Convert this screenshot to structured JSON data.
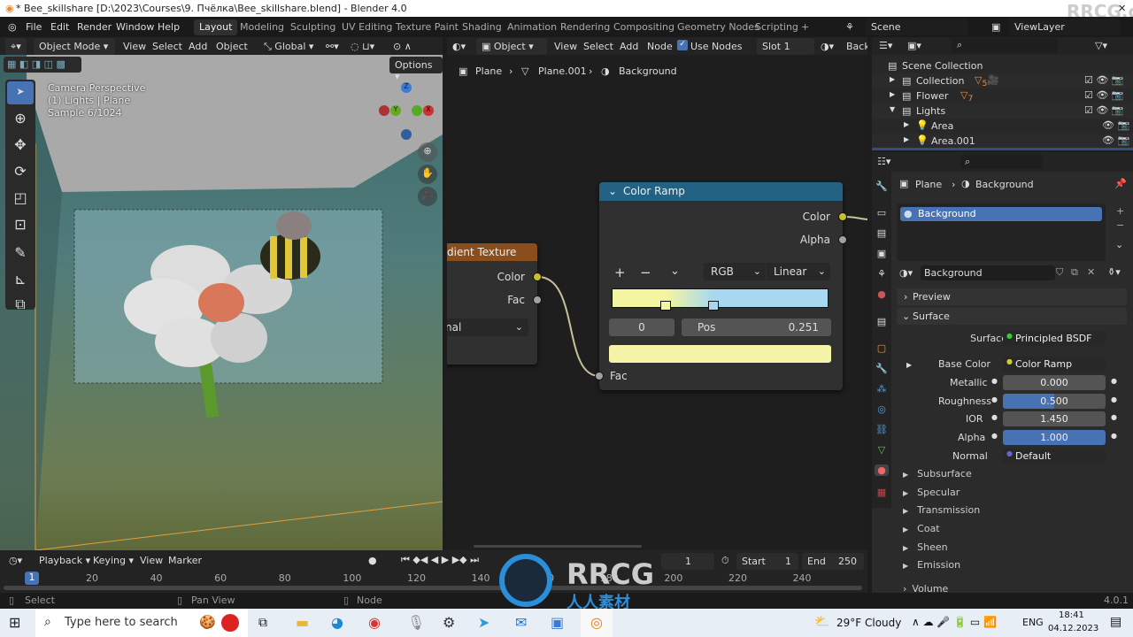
{
  "window": {
    "title": "* Bee_skillshare [D:\\2023\\Courses\\9. Пчёлка\\Bee_skillshare.blend] - Blender 4.0"
  },
  "menu": [
    "File",
    "Edit",
    "Render",
    "Window",
    "Help"
  ],
  "workspaces": [
    "Layout",
    "Modeling",
    "Sculpting",
    "UV Editing",
    "Texture Paint",
    "Shading",
    "Animation",
    "Rendering",
    "Compositing",
    "Geometry Nodes",
    "Scripting",
    "+"
  ],
  "scene": "Scene",
  "view_layer": "ViewLayer",
  "viewport": {
    "mode": "Object Mode",
    "menus": [
      "View",
      "Select",
      "Add",
      "Object"
    ],
    "transform": "Global",
    "options": "Options",
    "overlay": [
      "Camera Perspective",
      "(1) Lights | Plane",
      "Sample 6/1024"
    ],
    "gizmo": {
      "z": "Z",
      "y": "Y",
      "x": "X"
    }
  },
  "node_editor": {
    "type": "Object",
    "menus": [
      "View",
      "Select",
      "Add",
      "Node"
    ],
    "use_nodes": "Use Nodes",
    "slot": "Slot 1",
    "material": "Backg",
    "breadcrumb": [
      "Plane",
      "Plane.001",
      "Background"
    ],
    "gradient_node": {
      "title": "dient Texture",
      "outputs": [
        "Color",
        "Fac"
      ],
      "dropdown": "nal"
    },
    "color_ramp": {
      "title": "Color Ramp",
      "outputs": [
        "Color",
        "Alpha"
      ],
      "color_mode": "RGB",
      "interpolation": "Linear",
      "stop_index": "0",
      "pos_label": "Pos",
      "pos_value": "0.251",
      "input": "Fac",
      "stops": [
        0.251,
        0.47
      ],
      "colors": {
        "left": "#f3f5a0",
        "right": "#a8d8f0",
        "selected": "#f6f4a8"
      }
    }
  },
  "outliner": {
    "root": "Scene Collection",
    "items": [
      {
        "name": "Collection",
        "badge": "5"
      },
      {
        "name": "Flower",
        "badge": "7"
      },
      {
        "name": "Lights"
      },
      {
        "name": "Area"
      },
      {
        "name": "Area.001"
      }
    ]
  },
  "properties": {
    "breadcrumb": [
      "Plane",
      "Background"
    ],
    "slot": "Background",
    "material": "Background",
    "panels": {
      "preview": "Preview",
      "surface": "Surface"
    },
    "rows": [
      {
        "label": "Surface",
        "value": "Principled BSDF",
        "kind": "link"
      },
      {
        "label": "Base Color",
        "value": "Color Ramp",
        "kind": "link"
      },
      {
        "label": "Metallic",
        "value": "0.000",
        "fill": 0
      },
      {
        "label": "Roughness",
        "value": "0.500",
        "fill": 0.5
      },
      {
        "label": "IOR",
        "value": "1.450",
        "fill": 0
      },
      {
        "label": "Alpha",
        "value": "1.000",
        "fill": 1
      },
      {
        "label": "Normal",
        "value": "Default",
        "kind": "link"
      }
    ],
    "subpanels": [
      "Subsurface",
      "Specular",
      "Transmission",
      "Coat",
      "Sheen",
      "Emission"
    ],
    "volume": "Volume"
  },
  "timeline": {
    "menus": [
      "Playback",
      "Keying",
      "View",
      "Marker"
    ],
    "current": "1",
    "start_label": "Start",
    "start": "1",
    "end_label": "End",
    "end": "250",
    "ticks": [
      "20",
      "40",
      "60",
      "80",
      "100",
      "120",
      "140",
      "160",
      "180",
      "200",
      "220",
      "240"
    ],
    "frame_marker": "1"
  },
  "status": {
    "select": "Select",
    "pan": "Pan View",
    "node": "Node",
    "version": "4.0.1"
  },
  "taskbar": {
    "search": "Type here to search",
    "weather": "29°F Cloudy",
    "lang": "ENG",
    "time": "18:41",
    "date": "04.12.2023"
  },
  "watermark": {
    "top": "RRCG.cn",
    "logo": "RRCG",
    "sub": "人人素材"
  }
}
